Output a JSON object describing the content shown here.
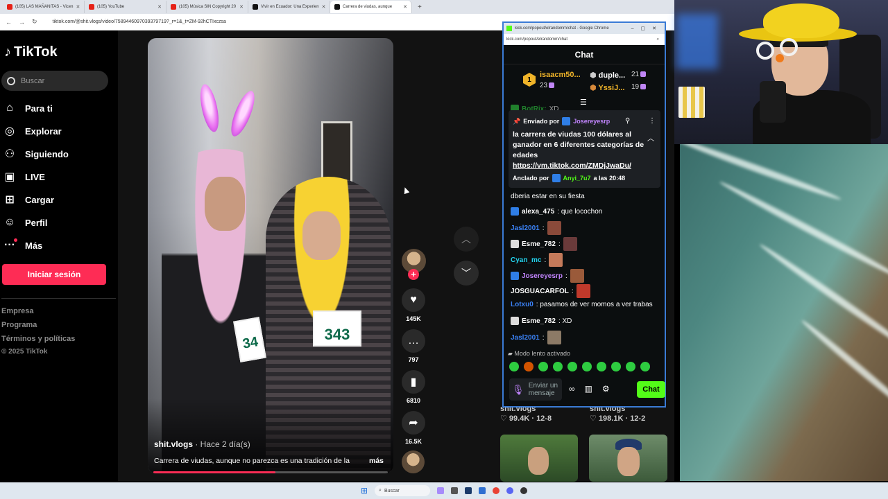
{
  "browser": {
    "tabs": [
      {
        "title": "(105) LAS MAÑANITAS - Vicen",
        "icon": "youtube-icon"
      },
      {
        "title": "(105) YouTube",
        "icon": "youtube-icon"
      },
      {
        "title": "(105) Música SIN Copyright 20",
        "icon": "youtube-icon"
      },
      {
        "title": "Vivir en Ecuador: Una Experien",
        "icon": "tiktok-icon"
      },
      {
        "title": "Carrera de viudas, aunque",
        "icon": "tiktok-icon"
      }
    ],
    "new_tab": "+",
    "url": "tiktok.com/@shit.vlogs/video/7589446097039379719?_r=1&_t=ZM-92hCTIxczsa"
  },
  "tiktok": {
    "logo": "TikTok",
    "search_placeholder": "Buscar",
    "nav": [
      {
        "label": "Para ti",
        "icon": "home-icon"
      },
      {
        "label": "Explorar",
        "icon": "compass-icon"
      },
      {
        "label": "Siguiendo",
        "icon": "following-icon"
      },
      {
        "label": "LIVE",
        "icon": "live-icon"
      },
      {
        "label": "Cargar",
        "icon": "upload-icon"
      },
      {
        "label": "Perfil",
        "icon": "profile-icon"
      },
      {
        "label": "Más",
        "icon": "more-icon"
      }
    ],
    "login": "Iniciar sesión",
    "footer": [
      "Empresa",
      "Programa",
      "Términos y políticas"
    ],
    "copyright": "© 2025 TikTok",
    "video": {
      "author": "shit.vlogs",
      "when": " · Hace 2 día(s)",
      "description": "Carrera de viudas, aunque no parezca es una tradición de la",
      "more": "más",
      "bib_left": "34",
      "bib_right": "343",
      "progress": 0.52
    },
    "actions": {
      "likes": "145K",
      "comments": "797",
      "saves": "6810",
      "shares": "16.5K"
    },
    "related": [
      {
        "author": "shit.vlogs",
        "likes": "99.4K",
        "date": "12-8"
      },
      {
        "author": "shit.vlogs",
        "likes": "198.1K",
        "date": "12-2"
      }
    ]
  },
  "kick": {
    "window_title": "kick.com/popout/elrandomm/chat - Google Chrome",
    "url": "kick.com/popout/elrandomm/chat",
    "header": "Chat",
    "leaderboard": {
      "first": {
        "rank": "1",
        "name": "isaacm50...",
        "count": "23"
      },
      "second": {
        "name": "duple...",
        "count": "21"
      },
      "third": {
        "name": "YssiJ...",
        "count": "19"
      }
    },
    "peek_user": "BotRix:",
    "peek_text": "XD",
    "pinned": {
      "sent_by": "Enviado por",
      "sender": "Josereyesrp",
      "text": "la carrera de viudas 100 dólares al ganador en 6 diferentes categorías de edades",
      "link": "https://vm.tiktok.com/ZMDjJwaDu/",
      "pinned_by": "Anclado por",
      "pinner": "Anyi_7u7",
      "pinned_at": "a las 20:48"
    },
    "messages": [
      {
        "user": "",
        "text": "dberia estar en su fiesta"
      },
      {
        "user": "alexa_475",
        "text": ": que locochon",
        "color": "#ffffff"
      },
      {
        "user": "Jasl2001",
        "text": ":",
        "color": "#3b82f6"
      },
      {
        "user": "Esme_782",
        "text": ":",
        "color": "#ffffff"
      },
      {
        "user": "Cyan_mc",
        "text": ":",
        "color": "#22d3ee"
      },
      {
        "user": "Josereyesrp",
        "text": ":",
        "color": "#c084fc"
      },
      {
        "user": "JOSGUACARFOL",
        "text": ":",
        "color": "#ffffff"
      },
      {
        "user": "Lotxu0",
        "text": ": pasamos de ver momos a ver trabas",
        "color": "#3b82f6"
      },
      {
        "user": "Esme_782",
        "text": ": XD",
        "color": "#ffffff"
      },
      {
        "user": "Jasl2001",
        "text": ":",
        "color": "#3b82f6"
      }
    ],
    "slow_mode": "Modo lento activado",
    "input_placeholder": "Enviar un mensaje",
    "send_button": "Chat",
    "accent": "#53fc18"
  },
  "taskbar": {
    "search": "Buscar"
  }
}
